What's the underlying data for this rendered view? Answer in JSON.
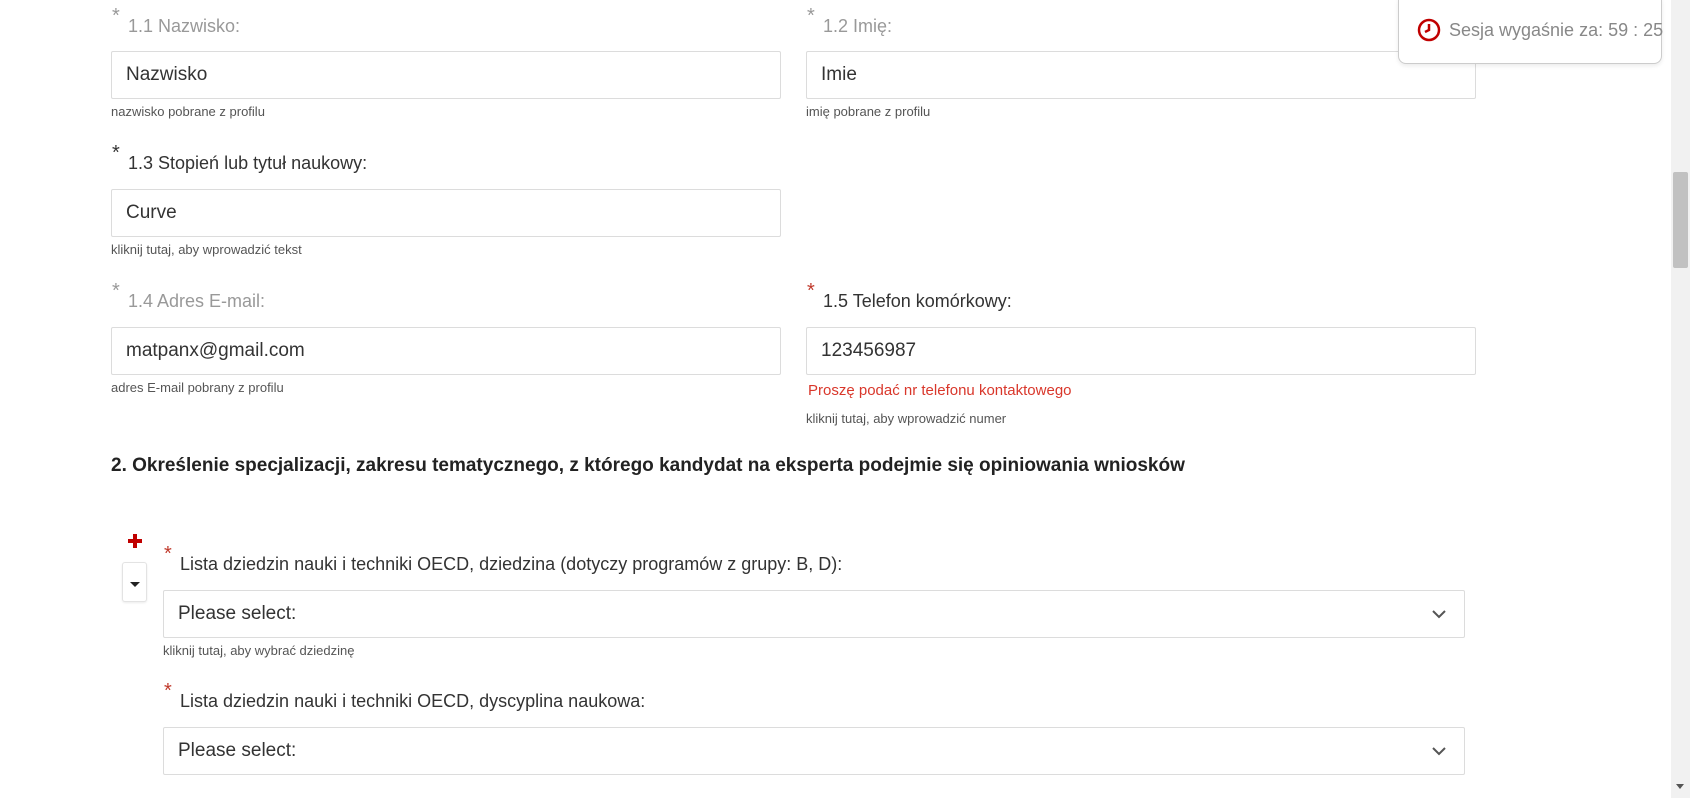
{
  "fields": {
    "surname": {
      "label": "1.1 Nazwisko:",
      "value": "Nazwisko",
      "hint": "nazwisko pobrane z profilu"
    },
    "firstname": {
      "label": "1.2 Imię:",
      "value": "Imie",
      "hint": "imię pobrane z profilu"
    },
    "degree": {
      "label": "1.3 Stopień lub tytuł naukowy:",
      "value": "Curve",
      "hint": "kliknij tutaj, aby wprowadzić tekst"
    },
    "email": {
      "label": "1.4 Adres E-mail:",
      "value": "matpanx@gmail.com",
      "hint": "adres E-mail pobrany z profilu"
    },
    "phone": {
      "label": "1.5 Telefon komórkowy:",
      "value": "123456987",
      "error": "Proszę podać nr telefonu kontaktowego",
      "hint": "kliknij tutaj, aby wprowadzić numer"
    }
  },
  "required_mark": "*",
  "section2": {
    "title": "2. Określenie specjalizacji, zakresu tematycznego, z którego kandydat na eksperta podejmie się opiniowania wniosków",
    "field_select": {
      "label": "Lista dziedzin nauki i techniki OECD, dziedzina (dotyczy programów z grupy: B, D):",
      "value": "Please select:",
      "hint": "kliknij tutaj, aby wybrać dziedzinę"
    },
    "discipline_select": {
      "label": "Lista dziedzin nauki i techniki OECD, dyscyplina naukowa:",
      "value": "Please select:"
    }
  },
  "session": {
    "text": "Sesja wygaśnie za: 59 : 25"
  },
  "icons": {
    "timer": "clock-icon",
    "add": "plus-icon",
    "collapse": "caret-down-icon",
    "select": "chevron-down-icon"
  },
  "colors": {
    "required_red": "#c0392b",
    "error_red": "#d9372b",
    "plus_red": "#c00000",
    "clock_red": "#c00000"
  }
}
